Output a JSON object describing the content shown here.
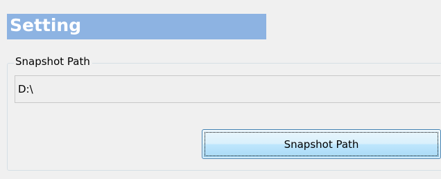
{
  "header": {
    "title": "Setting"
  },
  "snapshot_group": {
    "legend": "Snapshot Path",
    "path_value": "D:\\",
    "button_label": "Snapshot Path"
  },
  "colors": {
    "header_bar": "#8db3e2",
    "header_text": "#ffffff",
    "window_background": "#f0f0f0",
    "button_border": "#3c7fb1"
  }
}
